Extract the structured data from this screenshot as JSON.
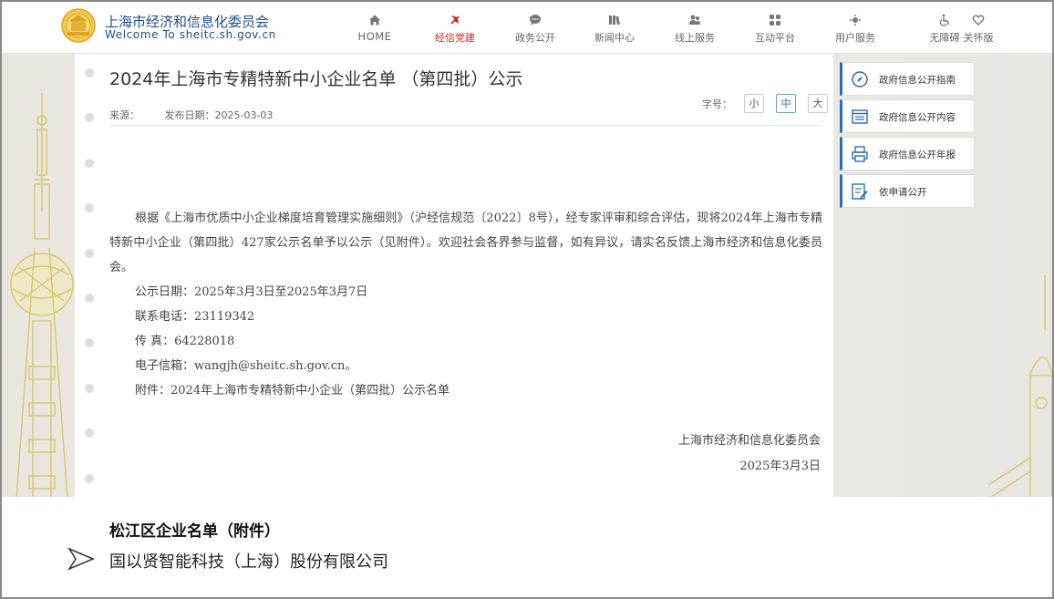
{
  "header": {
    "brand_cn": "上海市经济和信息化委员会",
    "brand_en": "Welcome To sheitc.sh.gov.cn",
    "nav": [
      {
        "label": "HOME",
        "icon": "home-icon"
      },
      {
        "label": "经信党建",
        "icon": "party-emblem-icon",
        "active": true
      },
      {
        "label": "政务公开",
        "icon": "chat-bubble-icon"
      },
      {
        "label": "新闻中心",
        "icon": "books-icon"
      },
      {
        "label": "线上服务",
        "icon": "users-icon"
      },
      {
        "label": "互动平台",
        "icon": "interaction-icon"
      },
      {
        "label": "用户服务",
        "icon": "user-service-icon"
      }
    ],
    "accessibility": {
      "barrier_free": "无障碍",
      "care_mode": "关怀版"
    }
  },
  "article": {
    "title": "2024年上海市专精特新中小企业名单  （第四批）公示",
    "source_label": "来源：",
    "date_label": "发布日期：",
    "date": "2025-03-03",
    "fontsize_label": "字号：",
    "fontsize_options": [
      "小",
      "中",
      "大"
    ],
    "fontsize_selected": "中",
    "paragraph": "根据《上海市优质中小企业梯度培育管理实施细则》（沪经信规范〔2022〕8号），经专家评审和综合评估，现将2024年上海市专精特新中小企业（第四批）427家公示名单予以公示（见附件）。欢迎社会各界参与监督，如有异议，请实名反馈上海市经济和信息化委员会。",
    "lines": [
      "公示日期：2025年3月3日至2025年3月7日",
      "联系电话：23119342",
      "传  真：64228018",
      "电子信箱：wangjh@sheitc.sh.gov.cn。",
      "附件：2024年上海市专精特新中小企业（第四批）公示名单"
    ],
    "signature_org": "上海市经济和信息化委员会",
    "signature_date": "2025年3月3日"
  },
  "sidebar": {
    "items": [
      {
        "label": "政府信息公开指南",
        "icon": "compass-icon"
      },
      {
        "label": "政府信息公开内容",
        "icon": "list-icon"
      },
      {
        "label": "政府信息公开年报",
        "icon": "printer-icon"
      },
      {
        "label": "依申请公开",
        "icon": "form-edit-icon"
      }
    ]
  },
  "overlay": {
    "title": "松江区企业名单（附件）",
    "company": "国以贤智能科技（上海）股份有限公司",
    "arrow_icon": "arrow-right-outline-icon"
  },
  "colors": {
    "brand": "#1f4e8c",
    "active": "#d6271f",
    "accent": "#2a6db5"
  }
}
